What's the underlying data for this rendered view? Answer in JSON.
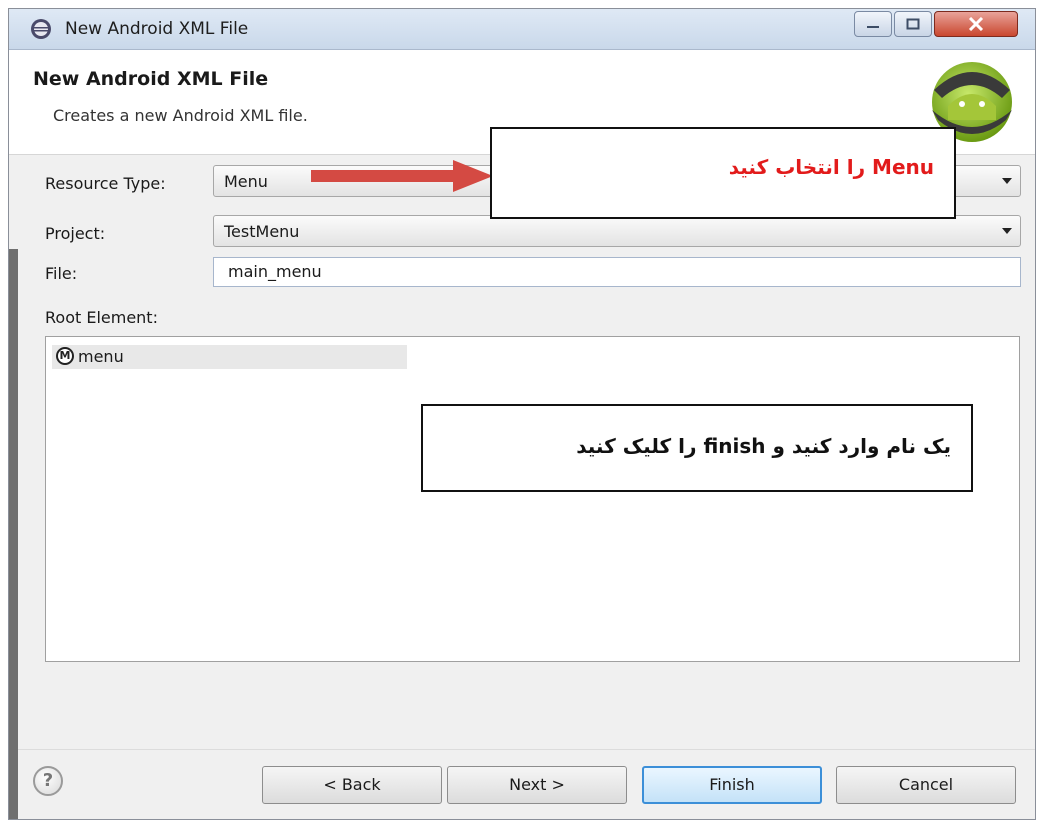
{
  "window": {
    "title": "New Android XML File"
  },
  "banner": {
    "title": "New Android XML File",
    "subtitle": "Creates a new Android XML file."
  },
  "form": {
    "resource_type_label": "Resource Type:",
    "resource_type_value": "Menu",
    "project_label": "Project:",
    "project_value": "TestMenu",
    "file_label": "File:",
    "file_value": "main_menu",
    "root_element_label": "Root Element:",
    "root_elements": [
      {
        "icon_letter": "M",
        "label": "menu"
      }
    ]
  },
  "buttons": {
    "help_glyph": "?",
    "back": "< Back",
    "next": "Next >",
    "finish": "Finish",
    "cancel": "Cancel"
  },
  "annotations": {
    "select_menu": "Menu را انتخاب کنید",
    "enter_name": "یک نام وارد کنید   و  finish را  کلیک کنید"
  },
  "colors": {
    "annotation_red": "#e21b1b",
    "arrow": "#d44a43",
    "finish_border": "#3c8fd8"
  }
}
